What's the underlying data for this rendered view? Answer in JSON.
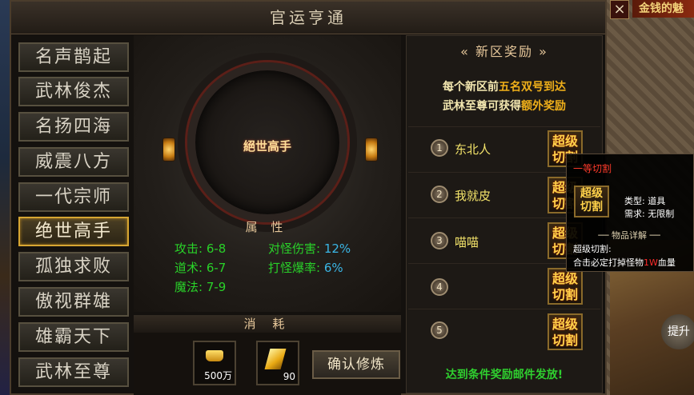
{
  "window": {
    "title": "官运亨通",
    "close": "×"
  },
  "background": {
    "banner": "金钱的魅",
    "up_button": "提升"
  },
  "ranks": [
    "名声鹊起",
    "武林俊杰",
    "名扬四海",
    "威震八方",
    "一代宗师",
    "绝世高手",
    "孤独求败",
    "傲视群雄",
    "雄霸天下",
    "武林至尊"
  ],
  "active_rank_index": 5,
  "center": {
    "title": "絕世高手",
    "attr_header": "属 性",
    "attrs": {
      "attack_label": "攻击: 6-8",
      "tao_label": "道术: 6-7",
      "magic_label": "魔法: 7-9",
      "monster_dmg_label": "对怪伤害: ",
      "monster_dmg_value": "12%",
      "monster_drop_label": "打怪爆率: ",
      "monster_drop_value": "6%"
    }
  },
  "cost": {
    "title": "消 耗",
    "items": [
      {
        "icon": "gold-ingot-icon",
        "qty": "500万"
      },
      {
        "icon": "gem-shard-icon",
        "qty": "90"
      }
    ],
    "confirm_label": "确认修炼"
  },
  "rewards": {
    "header": "新区奖励",
    "desc_line1_a": "每个新区前",
    "desc_line1_b": "五名双号到达",
    "desc_line2_a": "武林至尊可获得",
    "desc_line2_b": "额外奖励",
    "rows": [
      {
        "rank": "1",
        "name": "东北人",
        "reward": "超级切割"
      },
      {
        "rank": "2",
        "name": "我就皮",
        "reward": "超级切割"
      },
      {
        "rank": "3",
        "name": "喵喵",
        "reward": "超级切割"
      },
      {
        "rank": "4",
        "name": "",
        "reward": "超级切割"
      },
      {
        "rank": "5",
        "name": "",
        "reward": "超级切割"
      }
    ],
    "footer": "达到条件奖励邮件发放!"
  },
  "tooltip": {
    "name": "一等切割",
    "icon_text": "超级切割",
    "type": "类型: 道具",
    "need": "需求: 无限制",
    "separator": "物品详解",
    "desc1": "超级切割:",
    "desc2_a": "合击必定打掉怪物",
    "desc2_red": "1W",
    "desc2_b": "血量"
  },
  "colors": {
    "attr_green": "#29d129",
    "attr_blue": "#3ab6e6",
    "gold": "#f0b01a",
    "rank_active_border": "#d7a632"
  }
}
